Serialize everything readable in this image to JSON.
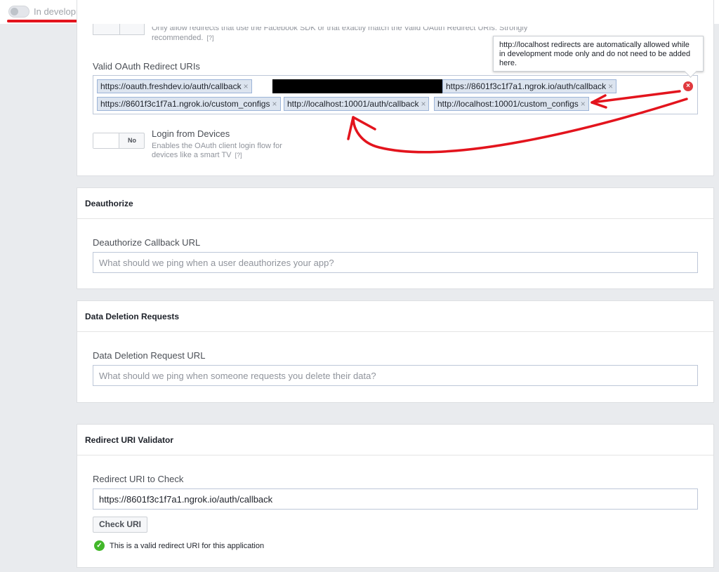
{
  "topbar": {
    "status_label": "In development",
    "underline_color": "#e3141d"
  },
  "oauth_card": {
    "strict_mode_desc_line1": "Only allow redirects that use the Facebook SDK or that exactly match the Valid OAuth Redirect URIs. Strongly",
    "strict_mode_desc_line2": "recommended.",
    "help_marker": "[?]",
    "redirect_uris_label": "Valid OAuth Redirect URIs",
    "tokens": [
      "https://oauth.freshdev.io/auth/callback",
      "https://8601f3c1f7a1.ngrok.io/auth/callback",
      "https://8601f3c1f7a1.ngrok.io/custom_configs",
      "http://localhost:10001/auth/callback",
      "http://localhost:10001/custom_configs"
    ],
    "token_remove_glyph": "×",
    "error_icon_glyph": "×",
    "tooltip_text": "http://localhost redirects are automatically allowed while in development mode only and do not need to be added here.",
    "login_devices": {
      "switch_label": "No",
      "title": "Login from Devices",
      "description": "Enables the OAuth client login flow for devices like a smart TV",
      "help_marker": "[?]"
    }
  },
  "deauthorize": {
    "header": "Deauthorize",
    "field_label": "Deauthorize Callback URL",
    "placeholder": "What should we ping when a user deauthorizes your app?"
  },
  "data_deletion": {
    "header": "Data Deletion Requests",
    "field_label": "Data Deletion Request URL",
    "placeholder": "What should we ping when someone requests you delete their data?"
  },
  "validator": {
    "header": "Redirect URI Validator",
    "field_label": "Redirect URI to Check",
    "value": "https://8601f3c1f7a1.ngrok.io/auth/callback",
    "button_label": "Check URI",
    "result_icon_glyph": "✓",
    "result_text": "This is a valid redirect URI for this application"
  },
  "annotation": {
    "arrow_color": "#e3141d"
  }
}
